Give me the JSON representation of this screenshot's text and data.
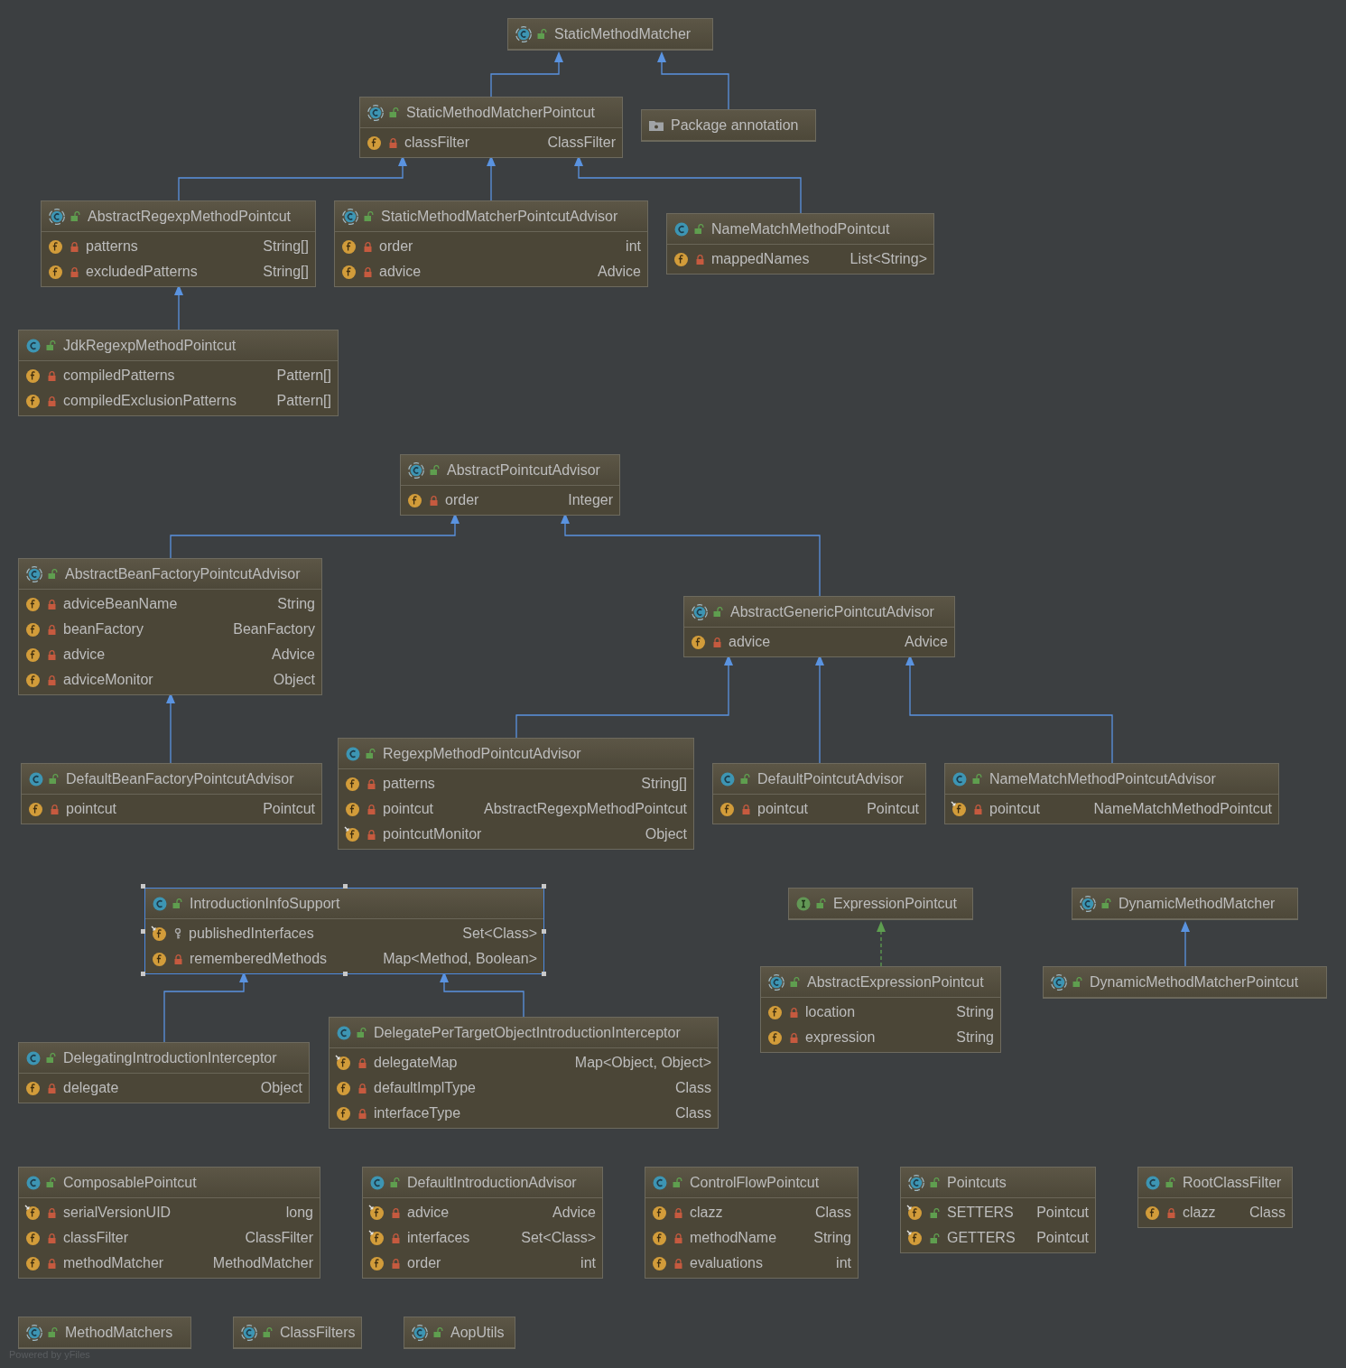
{
  "diagram": {
    "nodes": [
      {
        "kind": "abstract",
        "name": "StaticMethodMatcher",
        "access": {
          "kind": "public"
        },
        "selected": false
      },
      {
        "kind": "abstract",
        "name": "StaticMethodMatcherPointcut",
        "access": {
          "kind": "public"
        },
        "selected": false,
        "fields": [
          {
            "name": "classFilter",
            "type": "ClassFilter",
            "access": {
              "kind": "private"
            },
            "final": false
          }
        ]
      },
      {
        "kind": "package",
        "name": "Package annotation",
        "selected": false
      },
      {
        "kind": "abstract",
        "name": "AbstractRegexpMethodPointcut",
        "access": {
          "kind": "public"
        },
        "selected": false,
        "fields": [
          {
            "name": "patterns",
            "type": "String[]",
            "access": {
              "kind": "private"
            },
            "final": false
          },
          {
            "name": "excludedPatterns",
            "type": "String[]",
            "access": {
              "kind": "private"
            },
            "final": false
          }
        ]
      },
      {
        "kind": "abstract",
        "name": "StaticMethodMatcherPointcutAdvisor",
        "access": {
          "kind": "public"
        },
        "selected": false,
        "fields": [
          {
            "name": "order",
            "type": "int",
            "access": {
              "kind": "private"
            },
            "final": false
          },
          {
            "name": "advice",
            "type": "Advice",
            "access": {
              "kind": "private"
            },
            "final": false
          }
        ]
      },
      {
        "kind": "class",
        "name": "NameMatchMethodPointcut",
        "access": {
          "kind": "public"
        },
        "selected": false,
        "fields": [
          {
            "name": "mappedNames",
            "type": "List<String>",
            "access": {
              "kind": "private"
            },
            "final": false
          }
        ]
      },
      {
        "kind": "class",
        "name": "JdkRegexpMethodPointcut",
        "access": {
          "kind": "public"
        },
        "selected": false,
        "fields": [
          {
            "name": "compiledPatterns",
            "type": "Pattern[]",
            "access": {
              "kind": "private"
            },
            "final": false
          },
          {
            "name": "compiledExclusionPatterns",
            "type": "Pattern[]",
            "access": {
              "kind": "private"
            },
            "final": false
          }
        ]
      },
      {
        "kind": "abstract",
        "name": "AbstractPointcutAdvisor",
        "access": {
          "kind": "public"
        },
        "selected": false,
        "fields": [
          {
            "name": "order",
            "type": "Integer",
            "access": {
              "kind": "private"
            },
            "final": false
          }
        ]
      },
      {
        "kind": "abstract",
        "name": "AbstractBeanFactoryPointcutAdvisor",
        "access": {
          "kind": "public"
        },
        "selected": false,
        "fields": [
          {
            "name": "adviceBeanName",
            "type": "String",
            "access": {
              "kind": "private"
            },
            "final": false
          },
          {
            "name": "beanFactory",
            "type": "BeanFactory",
            "access": {
              "kind": "private"
            },
            "final": false
          },
          {
            "name": "advice",
            "type": "Advice",
            "access": {
              "kind": "private"
            },
            "final": false
          },
          {
            "name": "adviceMonitor",
            "type": "Object",
            "access": {
              "kind": "private"
            },
            "final": false
          }
        ]
      },
      {
        "kind": "abstract",
        "name": "AbstractGenericPointcutAdvisor",
        "access": {
          "kind": "public"
        },
        "selected": false,
        "fields": [
          {
            "name": "advice",
            "type": "Advice",
            "access": {
              "kind": "private"
            },
            "final": false
          }
        ]
      },
      {
        "kind": "class",
        "name": "DefaultBeanFactoryPointcutAdvisor",
        "access": {
          "kind": "public"
        },
        "selected": false,
        "fields": [
          {
            "name": "pointcut",
            "type": "Pointcut",
            "access": {
              "kind": "private"
            },
            "final": false
          }
        ]
      },
      {
        "kind": "class",
        "name": "RegexpMethodPointcutAdvisor",
        "access": {
          "kind": "public"
        },
        "selected": false,
        "fields": [
          {
            "name": "patterns",
            "type": "String[]",
            "access": {
              "kind": "private"
            },
            "final": false
          },
          {
            "name": "pointcut",
            "type": "AbstractRegexpMethodPointcut",
            "access": {
              "kind": "private"
            },
            "final": false
          },
          {
            "name": "pointcutMonitor",
            "type": "Object",
            "access": {
              "kind": "private"
            },
            "final": true
          }
        ]
      },
      {
        "kind": "class",
        "name": "DefaultPointcutAdvisor",
        "access": {
          "kind": "public"
        },
        "selected": false,
        "fields": [
          {
            "name": "pointcut",
            "type": "Pointcut",
            "access": {
              "kind": "private"
            },
            "final": false
          }
        ]
      },
      {
        "kind": "class",
        "name": "NameMatchMethodPointcutAdvisor",
        "access": {
          "kind": "public"
        },
        "selected": false,
        "fields": [
          {
            "name": "pointcut",
            "type": "NameMatchMethodPointcut",
            "access": {
              "kind": "private"
            },
            "final": true
          }
        ]
      },
      {
        "kind": "class",
        "name": "IntroductionInfoSupport",
        "access": {
          "kind": "public"
        },
        "selected": true,
        "fields": [
          {
            "name": "publishedInterfaces",
            "type": "Set<Class>",
            "access": {
              "kind": "protected"
            },
            "final": true
          },
          {
            "name": "rememberedMethods",
            "type": "Map<Method, Boolean>",
            "access": {
              "kind": "private"
            },
            "final": false
          }
        ]
      },
      {
        "kind": "interface",
        "name": "ExpressionPointcut",
        "access": {
          "kind": "public"
        },
        "selected": false
      },
      {
        "kind": "abstract",
        "name": "DynamicMethodMatcher",
        "access": {
          "kind": "public"
        },
        "selected": false
      },
      {
        "kind": "abstract",
        "name": "AbstractExpressionPointcut",
        "access": {
          "kind": "public"
        },
        "selected": false,
        "fields": [
          {
            "name": "location",
            "type": "String",
            "access": {
              "kind": "private"
            },
            "final": false
          },
          {
            "name": "expression",
            "type": "String",
            "access": {
              "kind": "private"
            },
            "final": false
          }
        ]
      },
      {
        "kind": "abstract",
        "name": "DynamicMethodMatcherPointcut",
        "access": {
          "kind": "public"
        },
        "selected": false
      },
      {
        "kind": "class",
        "name": "DelegatingIntroductionInterceptor",
        "access": {
          "kind": "public"
        },
        "selected": false,
        "fields": [
          {
            "name": "delegate",
            "type": "Object",
            "access": {
              "kind": "private"
            },
            "final": false
          }
        ]
      },
      {
        "kind": "class",
        "name": "DelegatePerTargetObjectIntroductionInterceptor",
        "access": {
          "kind": "public"
        },
        "selected": false,
        "fields": [
          {
            "name": "delegateMap",
            "type": "Map<Object, Object>",
            "access": {
              "kind": "private"
            },
            "final": true
          },
          {
            "name": "defaultImplType",
            "type": "Class",
            "access": {
              "kind": "private"
            },
            "final": false
          },
          {
            "name": "interfaceType",
            "type": "Class",
            "access": {
              "kind": "private"
            },
            "final": false
          }
        ]
      },
      {
        "kind": "class",
        "name": "ComposablePointcut",
        "access": {
          "kind": "public"
        },
        "selected": false,
        "fields": [
          {
            "name": "serialVersionUID",
            "type": "long",
            "access": {
              "kind": "private"
            },
            "final": true
          },
          {
            "name": "classFilter",
            "type": "ClassFilter",
            "access": {
              "kind": "private"
            },
            "final": false
          },
          {
            "name": "methodMatcher",
            "type": "MethodMatcher",
            "access": {
              "kind": "private"
            },
            "final": false
          }
        ]
      },
      {
        "kind": "class",
        "name": "DefaultIntroductionAdvisor",
        "access": {
          "kind": "public"
        },
        "selected": false,
        "fields": [
          {
            "name": "advice",
            "type": "Advice",
            "access": {
              "kind": "private"
            },
            "final": true
          },
          {
            "name": "interfaces",
            "type": "Set<Class>",
            "access": {
              "kind": "private"
            },
            "final": true
          },
          {
            "name": "order",
            "type": "int",
            "access": {
              "kind": "private"
            },
            "final": false
          }
        ]
      },
      {
        "kind": "class",
        "name": "ControlFlowPointcut",
        "access": {
          "kind": "public"
        },
        "selected": false,
        "fields": [
          {
            "name": "clazz",
            "type": "Class",
            "access": {
              "kind": "private"
            },
            "final": false
          },
          {
            "name": "methodName",
            "type": "String",
            "access": {
              "kind": "private"
            },
            "final": false
          },
          {
            "name": "evaluations",
            "type": "int",
            "access": {
              "kind": "private"
            },
            "final": false
          }
        ]
      },
      {
        "kind": "abstract",
        "name": "Pointcuts",
        "access": {
          "kind": "public"
        },
        "selected": false,
        "fields": [
          {
            "name": "SETTERS",
            "type": "Pointcut",
            "access": {
              "kind": "public"
            },
            "final": true
          },
          {
            "name": "GETTERS",
            "type": "Pointcut",
            "access": {
              "kind": "public"
            },
            "final": true
          }
        ]
      },
      {
        "kind": "class",
        "name": "RootClassFilter",
        "access": {
          "kind": "public"
        },
        "selected": false,
        "fields": [
          {
            "name": "clazz",
            "type": "Class",
            "access": {
              "kind": "private"
            },
            "final": false
          }
        ]
      },
      {
        "kind": "abstract",
        "name": "MethodMatchers",
        "access": {
          "kind": "public"
        },
        "selected": false
      },
      {
        "kind": "abstract",
        "name": "ClassFilters",
        "access": {
          "kind": "public"
        },
        "selected": false
      },
      {
        "kind": "abstract",
        "name": "AopUtils",
        "access": {
          "kind": "public"
        },
        "selected": false
      }
    ],
    "footer": "Powered by yFiles"
  }
}
